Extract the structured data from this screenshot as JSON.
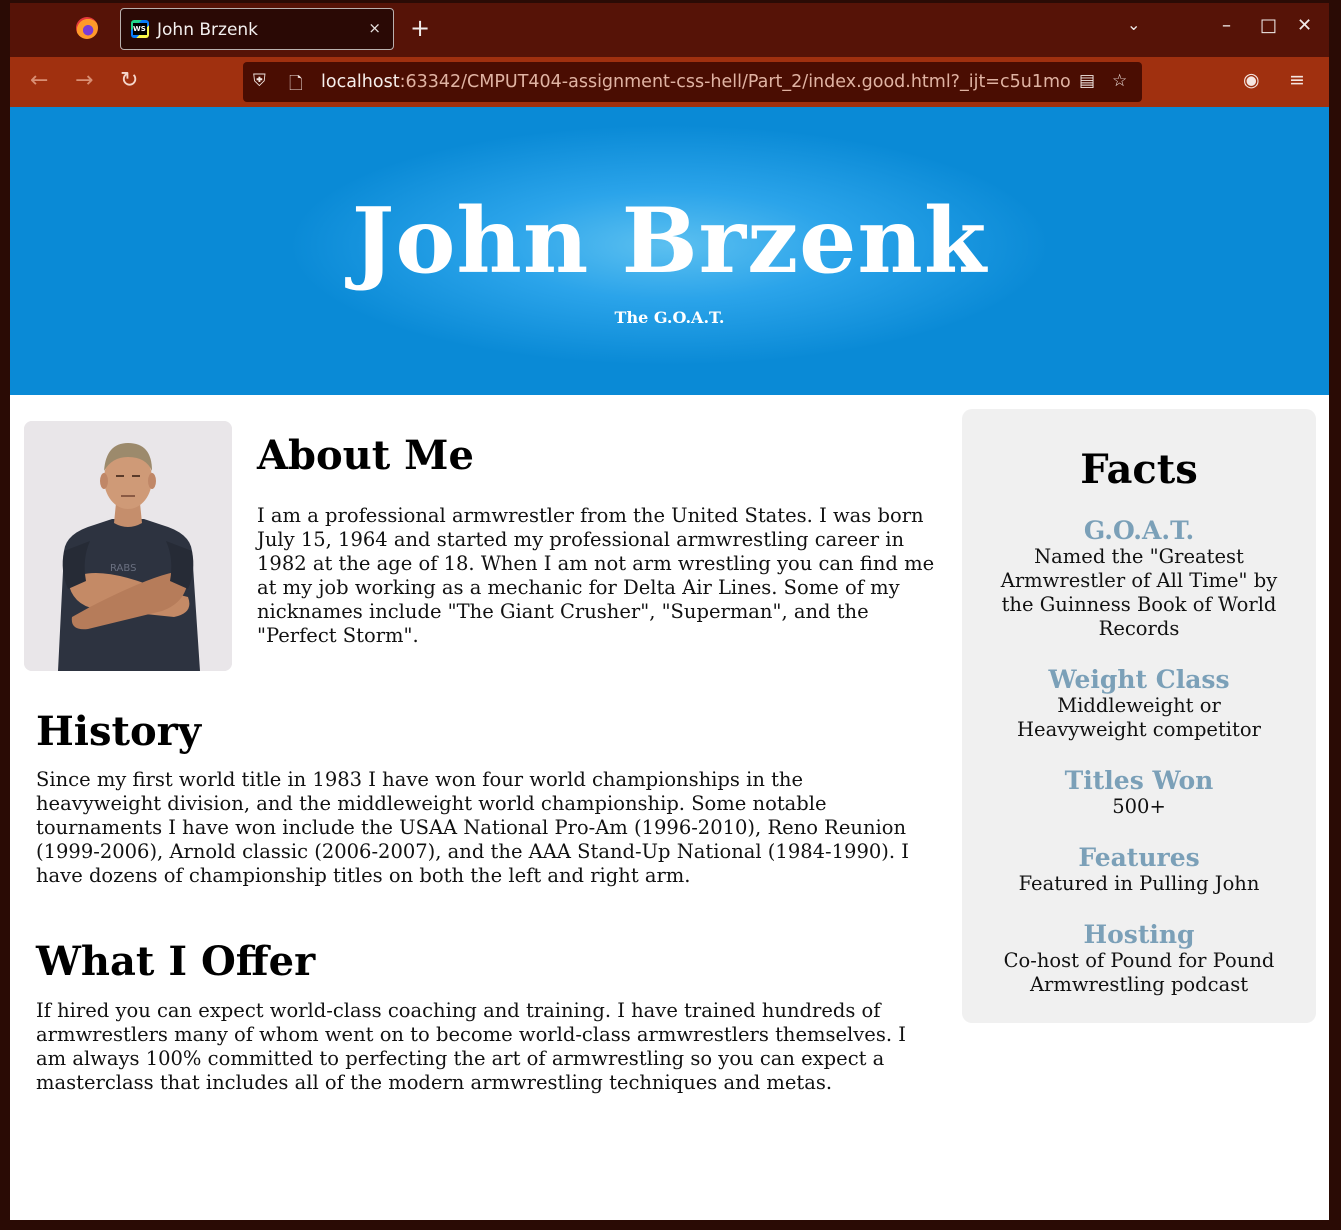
{
  "browser": {
    "tab_title": "John Brzenk",
    "tab_close": "×",
    "new_tab": "+",
    "url_host": "localhost",
    "url_rest": ":63342/CMPUT404-assignment-css-hell/Part_2/index.good.html?_ijt=c5u1mo"
  },
  "hero": {
    "title": "John Brzenk",
    "subtitle": "The G.O.A.T."
  },
  "about": {
    "heading": "About Me",
    "text": "I am a professional armwrestler from the United States. I was born July 15, 1964 and started my professional armwrestling career in 1982 at the age of 18. When I am not arm wrestling you can find me at my job working as a mechanic for Delta Air Lines. Some of my nicknames include \"The Giant Crusher\", \"Superman\", and the \"Perfect Storm\"."
  },
  "history": {
    "heading": "History",
    "text": "Since my first world title in 1983 I have won four world championships in the heavyweight division, and the middleweight world championship. Some notable tournaments I have won include the USAA National Pro-Am (1996-2010), Reno Reunion (1999-2006), Arnold classic (2006-2007), and the AAA Stand-Up National (1984-1990). I have dozens of championship titles on both the left and right arm."
  },
  "offer": {
    "heading": "What I Offer",
    "text": "If hired you can expect world-class coaching and training. I have trained hundreds of armwrestlers many of whom went on to become world-class armwrestlers themselves. I am always 100% committed to perfecting the art of armwrestling so you can expect a masterclass that includes all of the modern armwrestling techniques and metas."
  },
  "facts": {
    "title": "Facts",
    "items": [
      {
        "heading": "G.O.A.T.",
        "text": "Named the \"Greatest Armwrestler of All Time\" by the Guinness Book of World Records"
      },
      {
        "heading": "Weight Class",
        "text": "Middleweight or Heavyweight competitor"
      },
      {
        "heading": "Titles Won",
        "text": "500+"
      },
      {
        "heading": "Features",
        "text": "Featured in Pulling John"
      },
      {
        "heading": "Hosting",
        "text": "Co-host of Pound for Pound Armwrestling podcast"
      }
    ]
  },
  "colors": {
    "hero_blue": "#0a8ad6",
    "fact_heading": "#7ba0b8",
    "facts_bg": "#f0f0f0",
    "browser_nav": "#a0300f"
  }
}
